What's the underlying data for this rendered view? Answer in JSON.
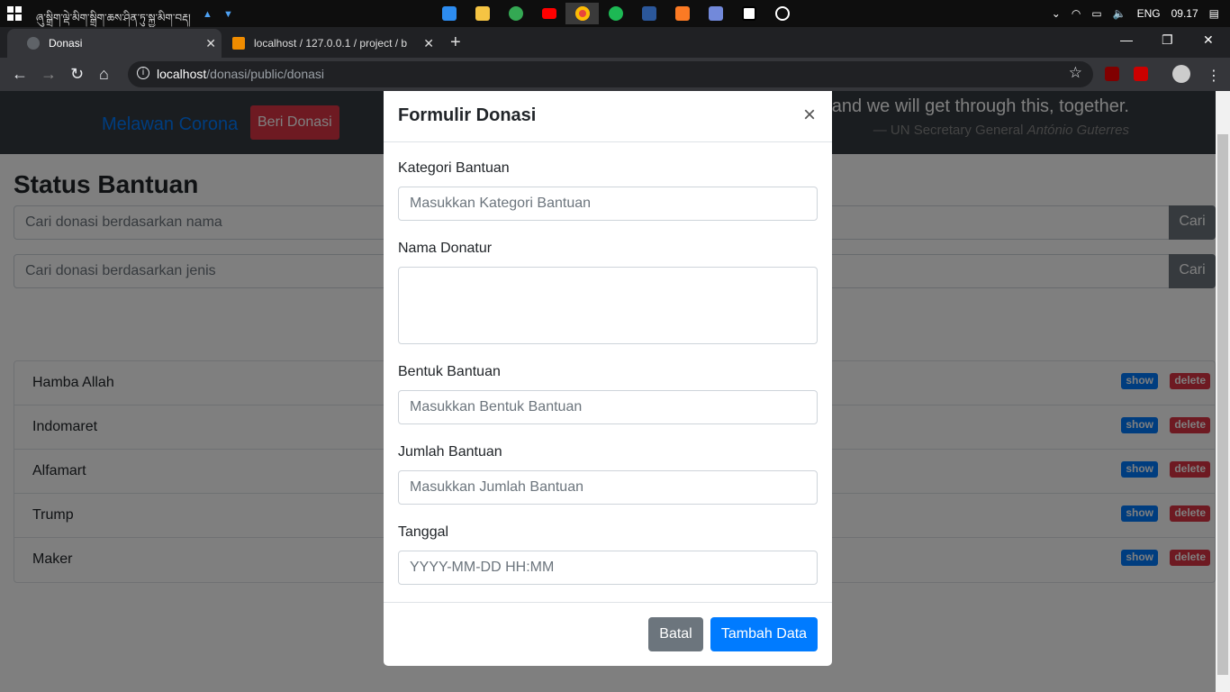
{
  "taskbar": {
    "tray_text": "ཞུ་སྒྲིག་ལྡེ་མིག་སྒྲིག་ཆས་ཤིན་ཏུ་སྐྱ་མིག་བརྡ།",
    "lang": "ENG",
    "time": "09.17",
    "apps": [
      "vscode-icon",
      "file-explorer-icon",
      "app-icon",
      "youtube-icon",
      "chrome-icon",
      "spotify-icon",
      "word-icon",
      "xampp-icon",
      "discord-icon",
      "7zip-icon",
      "app-power-icon"
    ]
  },
  "browser": {
    "tabs": [
      {
        "title": "Donasi"
      },
      {
        "title": "localhost / 127.0.0.1 / project / b"
      }
    ],
    "url_host": "localhost",
    "url_path": "/donasi/public/donasi"
  },
  "page": {
    "brand": "Melawan Corona",
    "beri_button": "Beri Donasi",
    "quote_line": "and we will get through this, together.",
    "quote_author_prefix": "— UN Secretary General",
    "quote_author_name": "António Guterres",
    "status_title": "Status Bantuan",
    "search_name_placeholder": "Cari donasi berdasarkan nama",
    "search_type_placeholder": "Cari donasi berdasarkan jenis",
    "search_button": "Cari",
    "show_label": "show",
    "delete_label": "delete",
    "donors": [
      "Hamba Allah",
      "Indomaret",
      "Alfamart",
      "Trump",
      "Maker"
    ]
  },
  "modal": {
    "title": "Formulir Donasi",
    "close": "×",
    "kategori_label": "Kategori Bantuan",
    "kategori_placeholder": "Masukkan Kategori Bantuan",
    "nama_label": "Nama Donatur",
    "bentuk_label": "Bentuk Bantuan",
    "bentuk_placeholder": "Masukkan Bentuk Bantuan",
    "jumlah_label": "Jumlah Bantuan",
    "jumlah_placeholder": "Masukkan Jumlah Bantuan",
    "tanggal_label": "Tanggal",
    "tanggal_placeholder": "YYYY-MM-DD HH:MM",
    "batal": "Batal",
    "tambah": "Tambah Data"
  },
  "colors": {
    "primary": "#007bff",
    "danger": "#dc3545",
    "secondary": "#6c757d",
    "navbar": "#343a40"
  }
}
